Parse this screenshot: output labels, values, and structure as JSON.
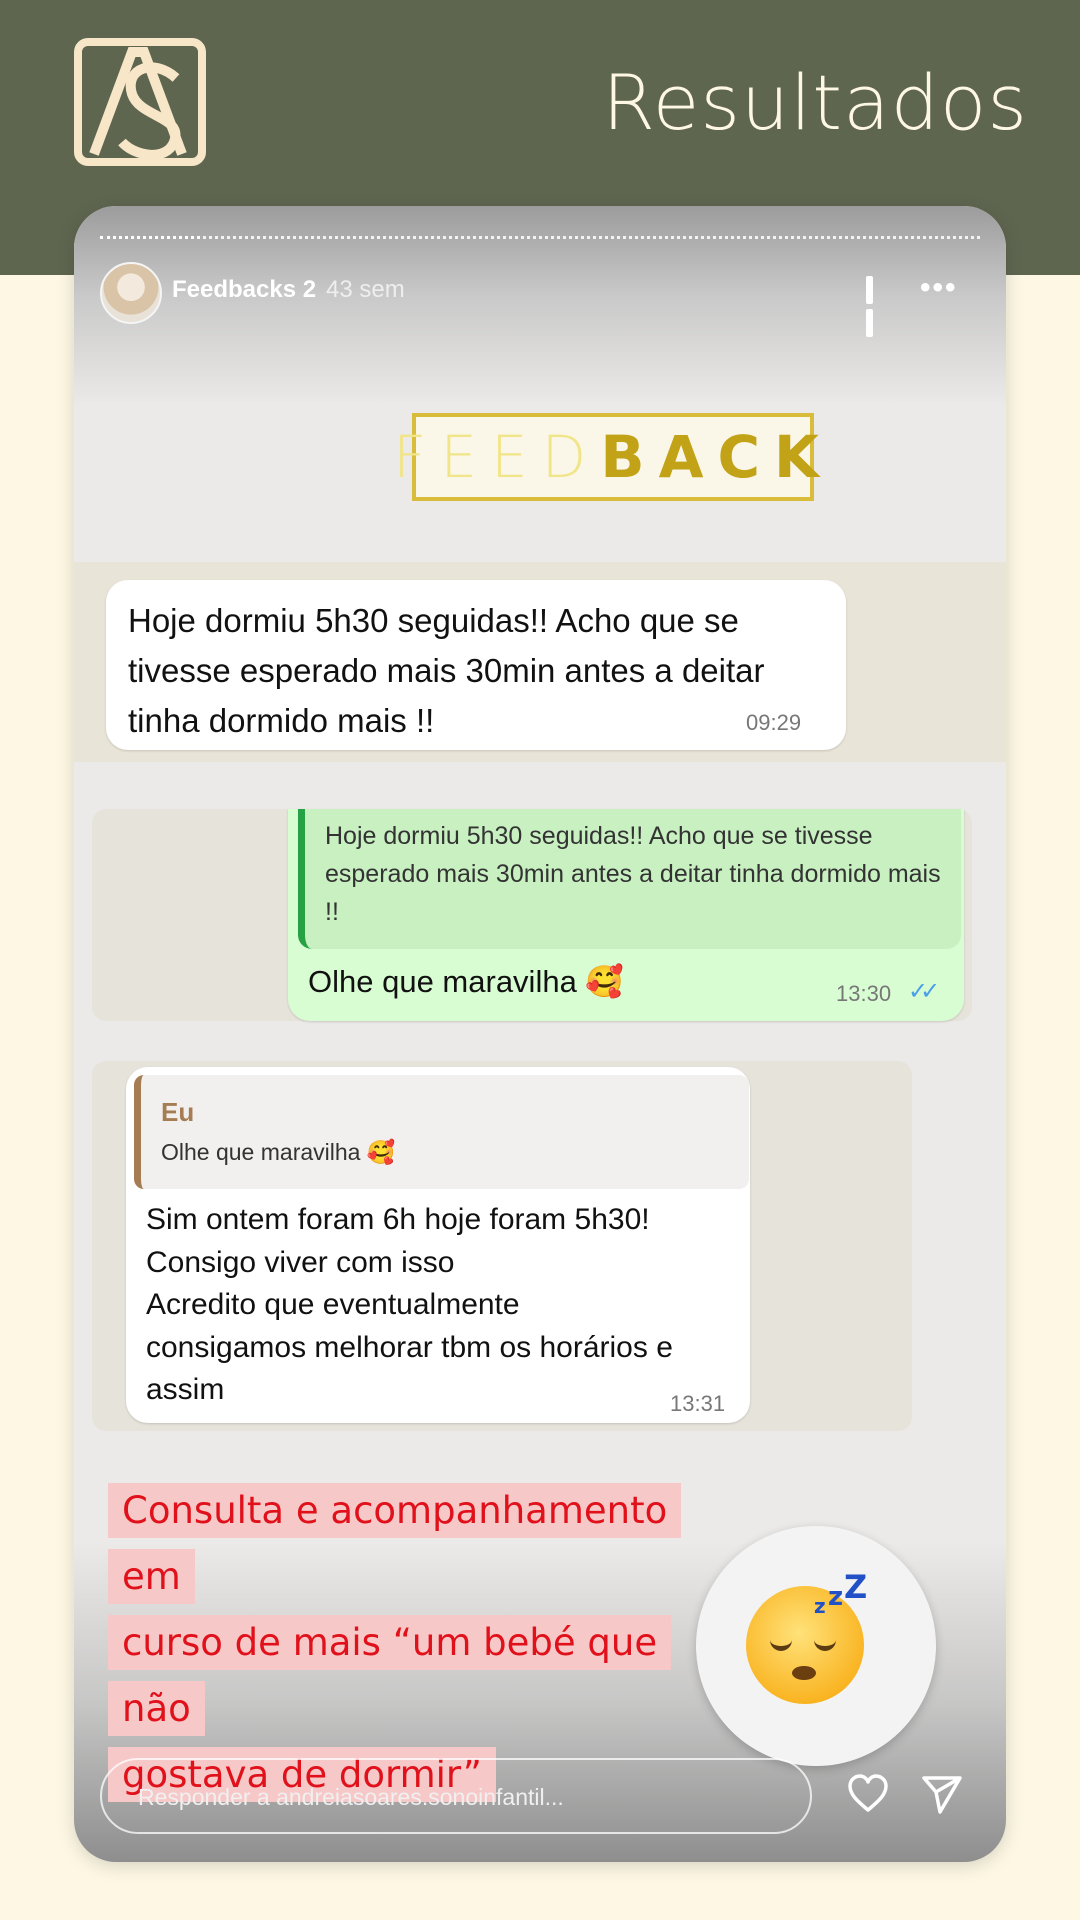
{
  "page": {
    "title": "Resultados"
  },
  "story": {
    "account": "Feedbacks 2",
    "time_ago": "43 sem",
    "reply_placeholder": "Responder a andreiasoares.sonoinfantil..."
  },
  "feedback_banner": {
    "light_part": "FEED",
    "bold_part": "BACK"
  },
  "messages": [
    {
      "text": "Hoje dormiu 5h30 seguidas!! Acho que se tivesse esperado mais 30min antes a deitar tinha dormido mais !!",
      "time": "09:29"
    },
    {
      "quoted_text": "Hoje dormiu 5h30 seguidas!! Acho que se tivesse esperado mais 30min antes a deitar tinha dormido mais !!",
      "text": "Olhe que maravilha 🥰",
      "time": "13:30",
      "ticks": "✓✓"
    },
    {
      "quoted_author": "Eu",
      "quoted_text": "Olhe que maravilha 🥰",
      "line1": "Sim ontem foram 6h hoje foram 5h30!",
      "line2": "Consigo viver com isso",
      "line3": "Acredito que eventualmente",
      "line4": "consigamos melhorar tbm os horários e",
      "line5": "assim",
      "time": "13:31"
    }
  ],
  "caption": {
    "line1": "Consulta e acompanhamento em",
    "line2": "curso de mais “um bebé que não",
    "line3": "gostava de dormir”"
  },
  "colors": {
    "header": "#5f6650",
    "background": "#fdf7e4",
    "caption_text": "#e0111b",
    "caption_bg": "#f7c8c8",
    "feedback_gold": "#d9bd3a",
    "sent_bubble": "#d9fdd3"
  },
  "icons": [
    "logo-monogram",
    "pause-icon",
    "more-icon",
    "sleeping-face-icon",
    "heart-icon",
    "send-icon",
    "double-check-icon"
  ]
}
